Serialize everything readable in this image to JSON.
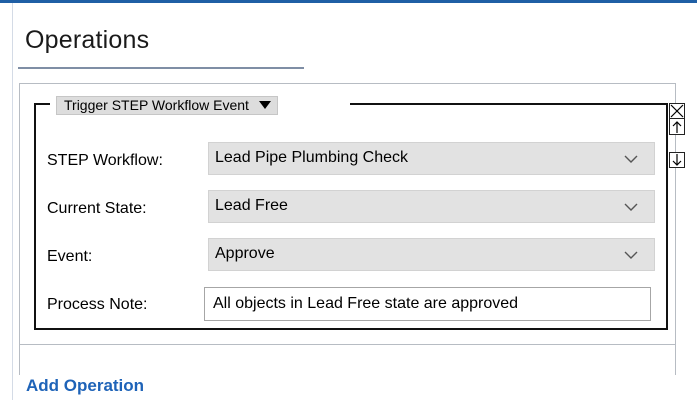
{
  "section": {
    "title": "Operations"
  },
  "operation": {
    "type_label": "Trigger STEP Workflow Event",
    "fields": {
      "workflow": {
        "label": "STEP Workflow:",
        "value": "Lead Pipe Plumbing Check"
      },
      "state": {
        "label": "Current State:",
        "value": "Lead Free"
      },
      "event": {
        "label": "Event:",
        "value": "Approve"
      },
      "note": {
        "label": "Process Note:",
        "value": "All objects in Lead Free state are approved"
      }
    },
    "icons": {
      "remove": "close-icon",
      "move_up": "arrow-up-icon",
      "move_down": "arrow-down-icon",
      "dropdown": "chevron-down-icon"
    }
  },
  "actions": {
    "add_operation": "Add Operation"
  },
  "colors": {
    "link": "#1e63b8",
    "header_rule": "#1f5fa5",
    "select_bg": "#e2e2e2"
  }
}
